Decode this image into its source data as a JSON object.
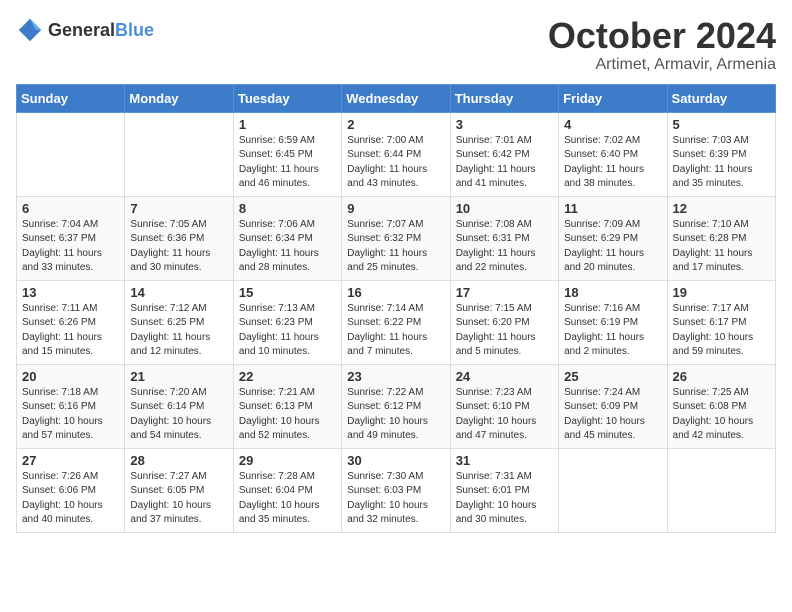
{
  "header": {
    "logo_general": "General",
    "logo_blue": "Blue",
    "month_title": "October 2024",
    "location": "Artimet, Armavir, Armenia"
  },
  "weekdays": [
    "Sunday",
    "Monday",
    "Tuesday",
    "Wednesday",
    "Thursday",
    "Friday",
    "Saturday"
  ],
  "weeks": [
    [
      {
        "day": "",
        "info": ""
      },
      {
        "day": "",
        "info": ""
      },
      {
        "day": "1",
        "info": "Sunrise: 6:59 AM\nSunset: 6:45 PM\nDaylight: 11 hours and 46 minutes."
      },
      {
        "day": "2",
        "info": "Sunrise: 7:00 AM\nSunset: 6:44 PM\nDaylight: 11 hours and 43 minutes."
      },
      {
        "day": "3",
        "info": "Sunrise: 7:01 AM\nSunset: 6:42 PM\nDaylight: 11 hours and 41 minutes."
      },
      {
        "day": "4",
        "info": "Sunrise: 7:02 AM\nSunset: 6:40 PM\nDaylight: 11 hours and 38 minutes."
      },
      {
        "day": "5",
        "info": "Sunrise: 7:03 AM\nSunset: 6:39 PM\nDaylight: 11 hours and 35 minutes."
      }
    ],
    [
      {
        "day": "6",
        "info": "Sunrise: 7:04 AM\nSunset: 6:37 PM\nDaylight: 11 hours and 33 minutes."
      },
      {
        "day": "7",
        "info": "Sunrise: 7:05 AM\nSunset: 6:36 PM\nDaylight: 11 hours and 30 minutes."
      },
      {
        "day": "8",
        "info": "Sunrise: 7:06 AM\nSunset: 6:34 PM\nDaylight: 11 hours and 28 minutes."
      },
      {
        "day": "9",
        "info": "Sunrise: 7:07 AM\nSunset: 6:32 PM\nDaylight: 11 hours and 25 minutes."
      },
      {
        "day": "10",
        "info": "Sunrise: 7:08 AM\nSunset: 6:31 PM\nDaylight: 11 hours and 22 minutes."
      },
      {
        "day": "11",
        "info": "Sunrise: 7:09 AM\nSunset: 6:29 PM\nDaylight: 11 hours and 20 minutes."
      },
      {
        "day": "12",
        "info": "Sunrise: 7:10 AM\nSunset: 6:28 PM\nDaylight: 11 hours and 17 minutes."
      }
    ],
    [
      {
        "day": "13",
        "info": "Sunrise: 7:11 AM\nSunset: 6:26 PM\nDaylight: 11 hours and 15 minutes."
      },
      {
        "day": "14",
        "info": "Sunrise: 7:12 AM\nSunset: 6:25 PM\nDaylight: 11 hours and 12 minutes."
      },
      {
        "day": "15",
        "info": "Sunrise: 7:13 AM\nSunset: 6:23 PM\nDaylight: 11 hours and 10 minutes."
      },
      {
        "day": "16",
        "info": "Sunrise: 7:14 AM\nSunset: 6:22 PM\nDaylight: 11 hours and 7 minutes."
      },
      {
        "day": "17",
        "info": "Sunrise: 7:15 AM\nSunset: 6:20 PM\nDaylight: 11 hours and 5 minutes."
      },
      {
        "day": "18",
        "info": "Sunrise: 7:16 AM\nSunset: 6:19 PM\nDaylight: 11 hours and 2 minutes."
      },
      {
        "day": "19",
        "info": "Sunrise: 7:17 AM\nSunset: 6:17 PM\nDaylight: 10 hours and 59 minutes."
      }
    ],
    [
      {
        "day": "20",
        "info": "Sunrise: 7:18 AM\nSunset: 6:16 PM\nDaylight: 10 hours and 57 minutes."
      },
      {
        "day": "21",
        "info": "Sunrise: 7:20 AM\nSunset: 6:14 PM\nDaylight: 10 hours and 54 minutes."
      },
      {
        "day": "22",
        "info": "Sunrise: 7:21 AM\nSunset: 6:13 PM\nDaylight: 10 hours and 52 minutes."
      },
      {
        "day": "23",
        "info": "Sunrise: 7:22 AM\nSunset: 6:12 PM\nDaylight: 10 hours and 49 minutes."
      },
      {
        "day": "24",
        "info": "Sunrise: 7:23 AM\nSunset: 6:10 PM\nDaylight: 10 hours and 47 minutes."
      },
      {
        "day": "25",
        "info": "Sunrise: 7:24 AM\nSunset: 6:09 PM\nDaylight: 10 hours and 45 minutes."
      },
      {
        "day": "26",
        "info": "Sunrise: 7:25 AM\nSunset: 6:08 PM\nDaylight: 10 hours and 42 minutes."
      }
    ],
    [
      {
        "day": "27",
        "info": "Sunrise: 7:26 AM\nSunset: 6:06 PM\nDaylight: 10 hours and 40 minutes."
      },
      {
        "day": "28",
        "info": "Sunrise: 7:27 AM\nSunset: 6:05 PM\nDaylight: 10 hours and 37 minutes."
      },
      {
        "day": "29",
        "info": "Sunrise: 7:28 AM\nSunset: 6:04 PM\nDaylight: 10 hours and 35 minutes."
      },
      {
        "day": "30",
        "info": "Sunrise: 7:30 AM\nSunset: 6:03 PM\nDaylight: 10 hours and 32 minutes."
      },
      {
        "day": "31",
        "info": "Sunrise: 7:31 AM\nSunset: 6:01 PM\nDaylight: 10 hours and 30 minutes."
      },
      {
        "day": "",
        "info": ""
      },
      {
        "day": "",
        "info": ""
      }
    ]
  ]
}
